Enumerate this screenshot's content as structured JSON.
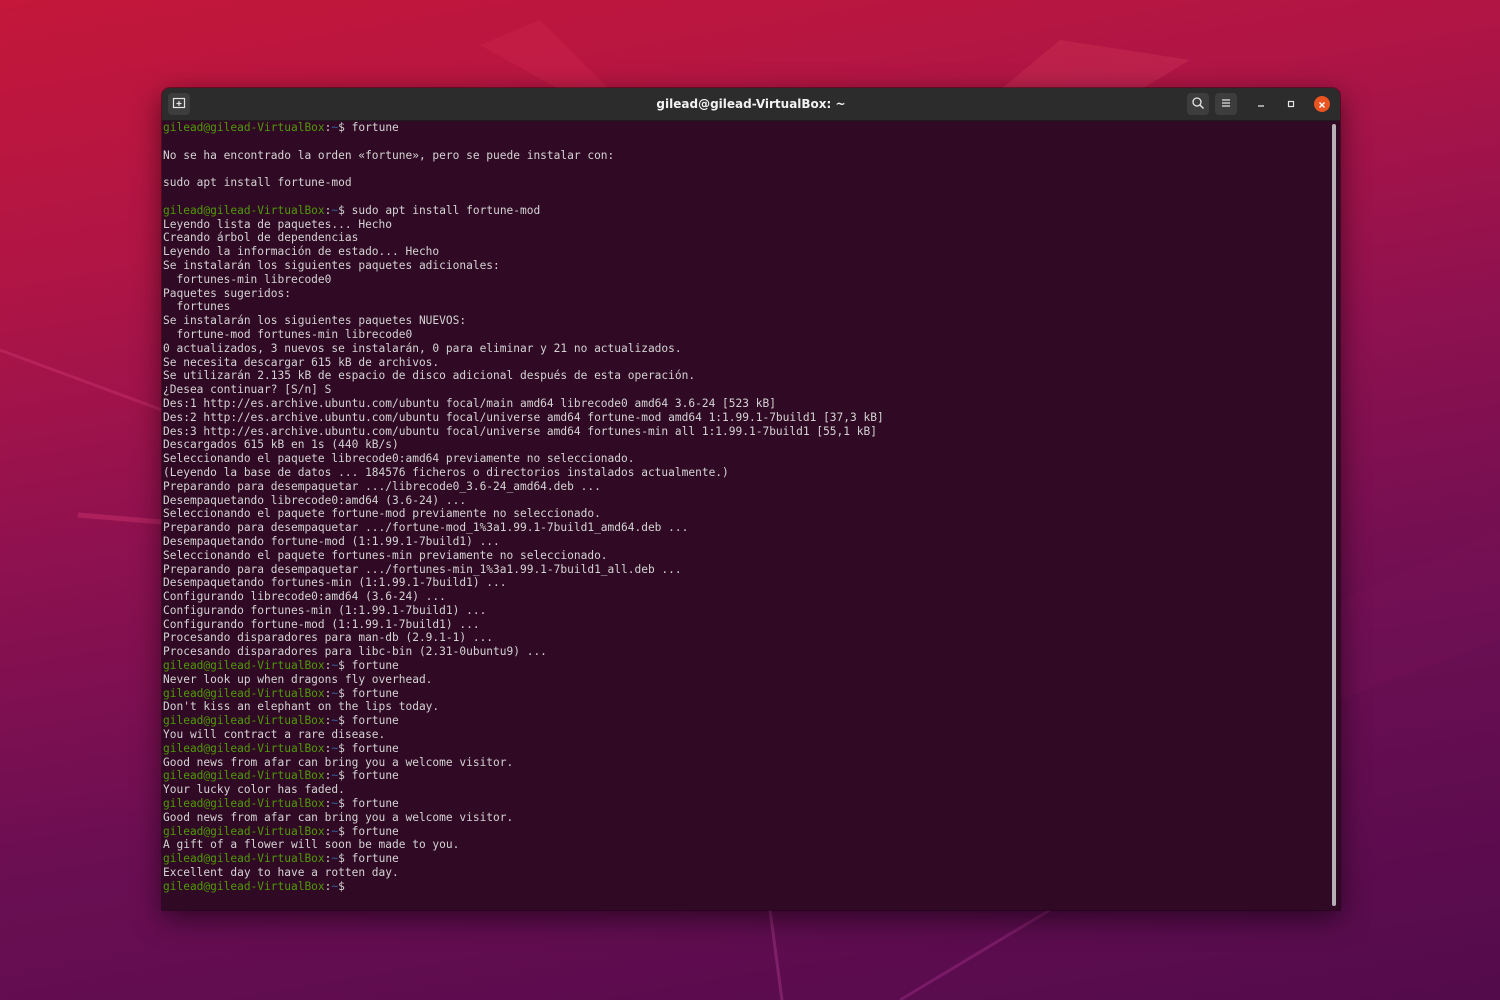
{
  "window": {
    "title": "gilead@gilead-VirtualBox: ~"
  },
  "titlebar_icons": {
    "new_tab": "new-tab-icon",
    "search": "search-icon",
    "menu": "hamburger-menu-icon",
    "minimize": "minimize-icon",
    "maximize": "maximize-icon",
    "close": "close-icon"
  },
  "colors": {
    "terminal_bg": "#300a24",
    "prompt_user": "#4e9a06",
    "prompt_path": "#3465a4",
    "text": "#d3d3d3",
    "close_button": "#e95420"
  },
  "prompt": {
    "user": "gilead@gilead-VirtualBox",
    "sep": ":",
    "path": "~",
    "symbol": "$ "
  },
  "terminal_lines": [
    {
      "type": "prompt",
      "cmd": "fortune"
    },
    {
      "type": "out",
      "text": ""
    },
    {
      "type": "out",
      "text": "No se ha encontrado la orden «fortune», pero se puede instalar con:"
    },
    {
      "type": "out",
      "text": ""
    },
    {
      "type": "out",
      "text": "sudo apt install fortune-mod"
    },
    {
      "type": "out",
      "text": ""
    },
    {
      "type": "prompt",
      "cmd": "sudo apt install fortune-mod"
    },
    {
      "type": "out",
      "text": "Leyendo lista de paquetes... Hecho"
    },
    {
      "type": "out",
      "text": "Creando árbol de dependencias"
    },
    {
      "type": "out",
      "text": "Leyendo la información de estado... Hecho"
    },
    {
      "type": "out",
      "text": "Se instalarán los siguientes paquetes adicionales:"
    },
    {
      "type": "out",
      "text": "  fortunes-min librecode0"
    },
    {
      "type": "out",
      "text": "Paquetes sugeridos:"
    },
    {
      "type": "out",
      "text": "  fortunes"
    },
    {
      "type": "out",
      "text": "Se instalarán los siguientes paquetes NUEVOS:"
    },
    {
      "type": "out",
      "text": "  fortune-mod fortunes-min librecode0"
    },
    {
      "type": "out",
      "text": "0 actualizados, 3 nuevos se instalarán, 0 para eliminar y 21 no actualizados."
    },
    {
      "type": "out",
      "text": "Se necesita descargar 615 kB de archivos."
    },
    {
      "type": "out",
      "text": "Se utilizarán 2.135 kB de espacio de disco adicional después de esta operación."
    },
    {
      "type": "out",
      "text": "¿Desea continuar? [S/n] S"
    },
    {
      "type": "out",
      "text": "Des:1 http://es.archive.ubuntu.com/ubuntu focal/main amd64 librecode0 amd64 3.6-24 [523 kB]"
    },
    {
      "type": "out",
      "text": "Des:2 http://es.archive.ubuntu.com/ubuntu focal/universe amd64 fortune-mod amd64 1:1.99.1-7build1 [37,3 kB]"
    },
    {
      "type": "out",
      "text": "Des:3 http://es.archive.ubuntu.com/ubuntu focal/universe amd64 fortunes-min all 1:1.99.1-7build1 [55,1 kB]"
    },
    {
      "type": "out",
      "text": "Descargados 615 kB en 1s (440 kB/s)"
    },
    {
      "type": "out",
      "text": "Seleccionando el paquete librecode0:amd64 previamente no seleccionado."
    },
    {
      "type": "out",
      "text": "(Leyendo la base de datos ... 184576 ficheros o directorios instalados actualmente.)"
    },
    {
      "type": "out",
      "text": "Preparando para desempaquetar .../librecode0_3.6-24_amd64.deb ..."
    },
    {
      "type": "out",
      "text": "Desempaquetando librecode0:amd64 (3.6-24) ..."
    },
    {
      "type": "out",
      "text": "Seleccionando el paquete fortune-mod previamente no seleccionado."
    },
    {
      "type": "out",
      "text": "Preparando para desempaquetar .../fortune-mod_1%3a1.99.1-7build1_amd64.deb ..."
    },
    {
      "type": "out",
      "text": "Desempaquetando fortune-mod (1:1.99.1-7build1) ..."
    },
    {
      "type": "out",
      "text": "Seleccionando el paquete fortunes-min previamente no seleccionado."
    },
    {
      "type": "out",
      "text": "Preparando para desempaquetar .../fortunes-min_1%3a1.99.1-7build1_all.deb ..."
    },
    {
      "type": "out",
      "text": "Desempaquetando fortunes-min (1:1.99.1-7build1) ..."
    },
    {
      "type": "out",
      "text": "Configurando librecode0:amd64 (3.6-24) ..."
    },
    {
      "type": "out",
      "text": "Configurando fortunes-min (1:1.99.1-7build1) ..."
    },
    {
      "type": "out",
      "text": "Configurando fortune-mod (1:1.99.1-7build1) ..."
    },
    {
      "type": "out",
      "text": "Procesando disparadores para man-db (2.9.1-1) ..."
    },
    {
      "type": "out",
      "text": "Procesando disparadores para libc-bin (2.31-0ubuntu9) ..."
    },
    {
      "type": "prompt",
      "cmd": "fortune"
    },
    {
      "type": "out",
      "text": "Never look up when dragons fly overhead."
    },
    {
      "type": "prompt",
      "cmd": "fortune"
    },
    {
      "type": "out",
      "text": "Don't kiss an elephant on the lips today."
    },
    {
      "type": "prompt",
      "cmd": "fortune"
    },
    {
      "type": "out",
      "text": "You will contract a rare disease."
    },
    {
      "type": "prompt",
      "cmd": "fortune"
    },
    {
      "type": "out",
      "text": "Good news from afar can bring you a welcome visitor."
    },
    {
      "type": "prompt",
      "cmd": "fortune"
    },
    {
      "type": "out",
      "text": "Your lucky color has faded."
    },
    {
      "type": "prompt",
      "cmd": "fortune"
    },
    {
      "type": "out",
      "text": "Good news from afar can bring you a welcome visitor."
    },
    {
      "type": "prompt",
      "cmd": "fortune"
    },
    {
      "type": "out",
      "text": "A gift of a flower will soon be made to you."
    },
    {
      "type": "prompt",
      "cmd": "fortune"
    },
    {
      "type": "out",
      "text": "Excellent day to have a rotten day."
    },
    {
      "type": "prompt",
      "cmd": ""
    }
  ]
}
